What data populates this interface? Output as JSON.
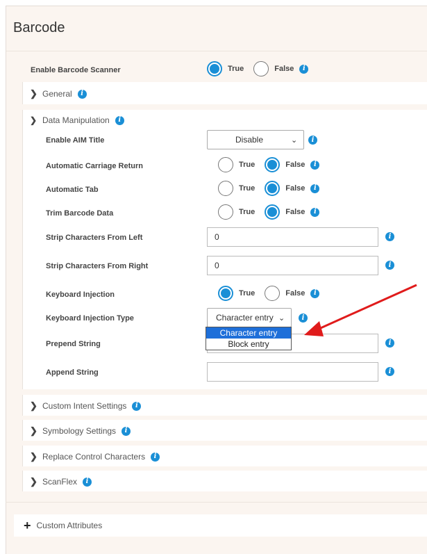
{
  "panel": {
    "title": "Barcode"
  },
  "enable_scanner": {
    "label": "Enable Barcode Scanner",
    "true_label": "True",
    "false_label": "False",
    "selected": "True"
  },
  "sections": {
    "general": "General",
    "data_manipulation": "Data Manipulation",
    "custom_intent": "Custom Intent Settings",
    "symbology": "Symbology Settings",
    "replace_control": "Replace Control Characters",
    "scanflex": "ScanFlex"
  },
  "dm": {
    "aim_title": {
      "label": "Enable AIM Title",
      "value": "Disable"
    },
    "carriage_return": {
      "label": "Automatic Carriage Return",
      "true_label": "True",
      "false_label": "False",
      "selected": "False"
    },
    "auto_tab": {
      "label": "Automatic Tab",
      "true_label": "True",
      "false_label": "False",
      "selected": "False"
    },
    "trim": {
      "label": "Trim Barcode Data",
      "true_label": "True",
      "false_label": "False",
      "selected": "False"
    },
    "strip_left": {
      "label": "Strip Characters From Left",
      "value": "0"
    },
    "strip_right": {
      "label": "Strip Characters From Right",
      "value": "0"
    },
    "keyboard_injection": {
      "label": "Keyboard Injection",
      "true_label": "True",
      "false_label": "False",
      "selected": "True"
    },
    "injection_type": {
      "label": "Keyboard Injection Type",
      "value": "Character entry",
      "options": [
        "Character entry",
        "Block entry"
      ]
    },
    "prepend": {
      "label": "Prepend String",
      "value": ""
    },
    "append": {
      "label": "Append String",
      "value": ""
    }
  },
  "custom_attributes": "Custom Attributes",
  "colors": {
    "accent": "#1a8fd6",
    "arrow": "#e01b1b",
    "dropdown_highlight": "#1e6fd9",
    "panel_bg": "#fbf5f0"
  },
  "icons": {
    "info": "info-icon",
    "collapsed": "chevron-right-icon",
    "expanded": "chevron-down-icon",
    "select": "chevron-down-icon",
    "add": "plus-icon"
  }
}
